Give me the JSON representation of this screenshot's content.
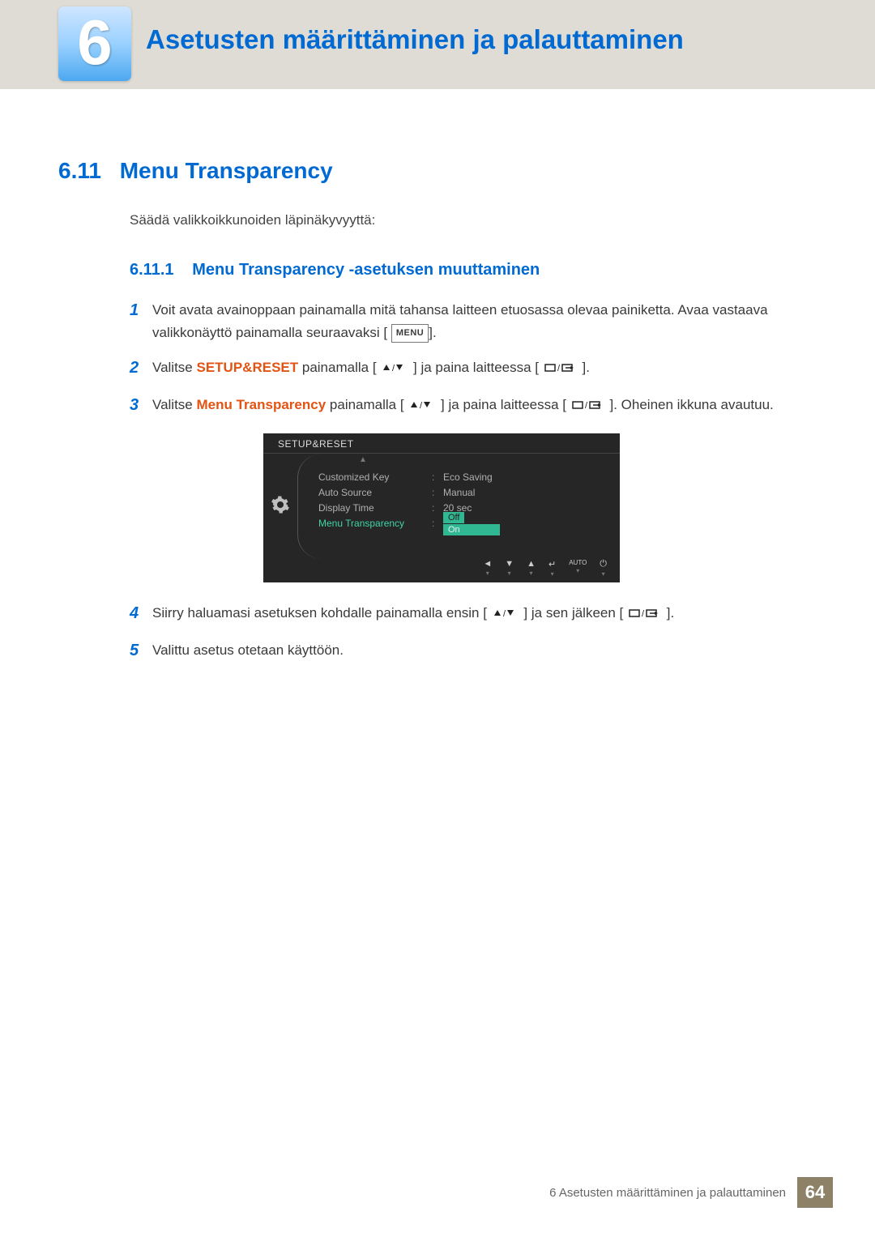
{
  "chapter": {
    "number": "6",
    "title": "Asetusten määrittäminen ja palauttaminen"
  },
  "section": {
    "number": "6.11",
    "title": "Menu Transparency",
    "intro": "Säädä valikkoikkunoiden läpinäkyvyyttä:"
  },
  "subsection": {
    "number": "6.11.1",
    "title": "Menu Transparency -asetuksen muuttaminen"
  },
  "icons": {
    "menu": "MENU"
  },
  "steps": [
    {
      "num": "1",
      "pre": "Voit avata avainoppaan painamalla mitä tahansa laitteen etuosassa olevaa painiketta. Avaa vastaava valikkonäyttö painamalla seuraavaksi [",
      "post": "]."
    },
    {
      "num": "2",
      "t1": "Valitse ",
      "hl": "SETUP&RESET",
      "t2": " painamalla [",
      "t3": "] ja paina laitteessa [",
      "t4": "]."
    },
    {
      "num": "3",
      "t1": "Valitse ",
      "hl": "Menu Transparency",
      "t2": " painamalla [",
      "t3": "] ja paina laitteessa [",
      "t4": "]. Oheinen ikkuna avautuu."
    },
    {
      "num": "4",
      "t1": "Siirry haluamasi asetuksen kohdalle painamalla ensin [",
      "t2": "] ja sen jälkeen [",
      "t3": "]."
    },
    {
      "num": "5",
      "t1": "Valittu asetus otetaan käyttöön."
    }
  ],
  "osd": {
    "title": "SETUP&RESET",
    "rows": [
      {
        "key": "Customized Key",
        "val": "Eco Saving"
      },
      {
        "key": "Auto Source",
        "val": "Manual"
      },
      {
        "key": "Display Time",
        "val": "20 sec"
      },
      {
        "key": "Menu Transparency",
        "options": [
          "Off",
          "On"
        ]
      }
    ],
    "footer": {
      "auto": "AUTO"
    }
  },
  "footer": {
    "label": "6 Asetusten määrittäminen ja palauttaminen",
    "page": "64"
  }
}
